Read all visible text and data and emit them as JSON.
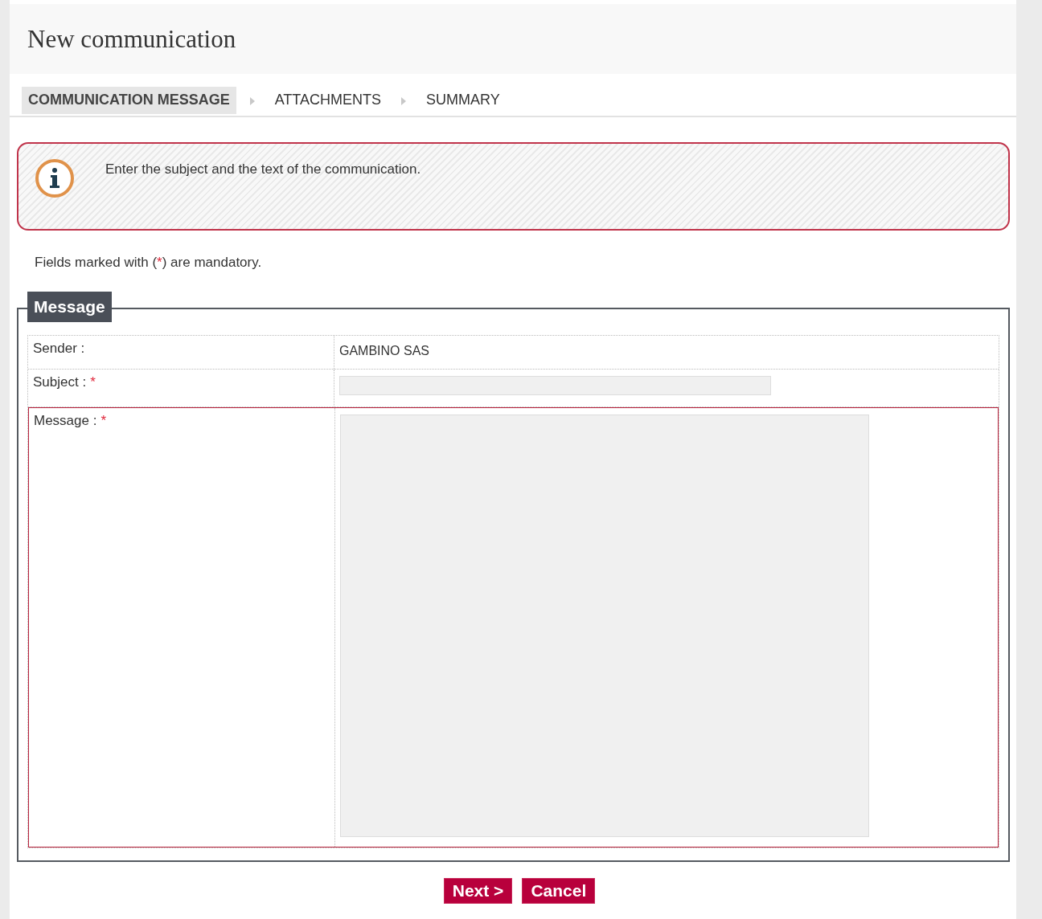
{
  "page": {
    "title": "New communication"
  },
  "steps": [
    {
      "label": "COMMUNICATION MESSAGE",
      "selected": true
    },
    {
      "label": "ATTACHMENTS",
      "selected": false
    },
    {
      "label": "SUMMARY",
      "selected": false
    }
  ],
  "info": {
    "text": "Enter the subject and the text of the communication."
  },
  "mandatory_note": {
    "before": "Fields marked with (",
    "mark": "*",
    "after": ") are mandatory."
  },
  "fieldset": {
    "legend": "Message",
    "rows": [
      {
        "kind": "text",
        "label": "Sender :",
        "error": false,
        "value": "GAMBINO SAS"
      },
      {
        "kind": "input",
        "label": "Subject :",
        "required_mark": "*",
        "error": false
      },
      {
        "kind": "textarea",
        "label": "Message :",
        "required_mark": "*",
        "error": true
      }
    ]
  },
  "buttons": [
    {
      "label": "Next >"
    },
    {
      "label": "Cancel"
    }
  ]
}
